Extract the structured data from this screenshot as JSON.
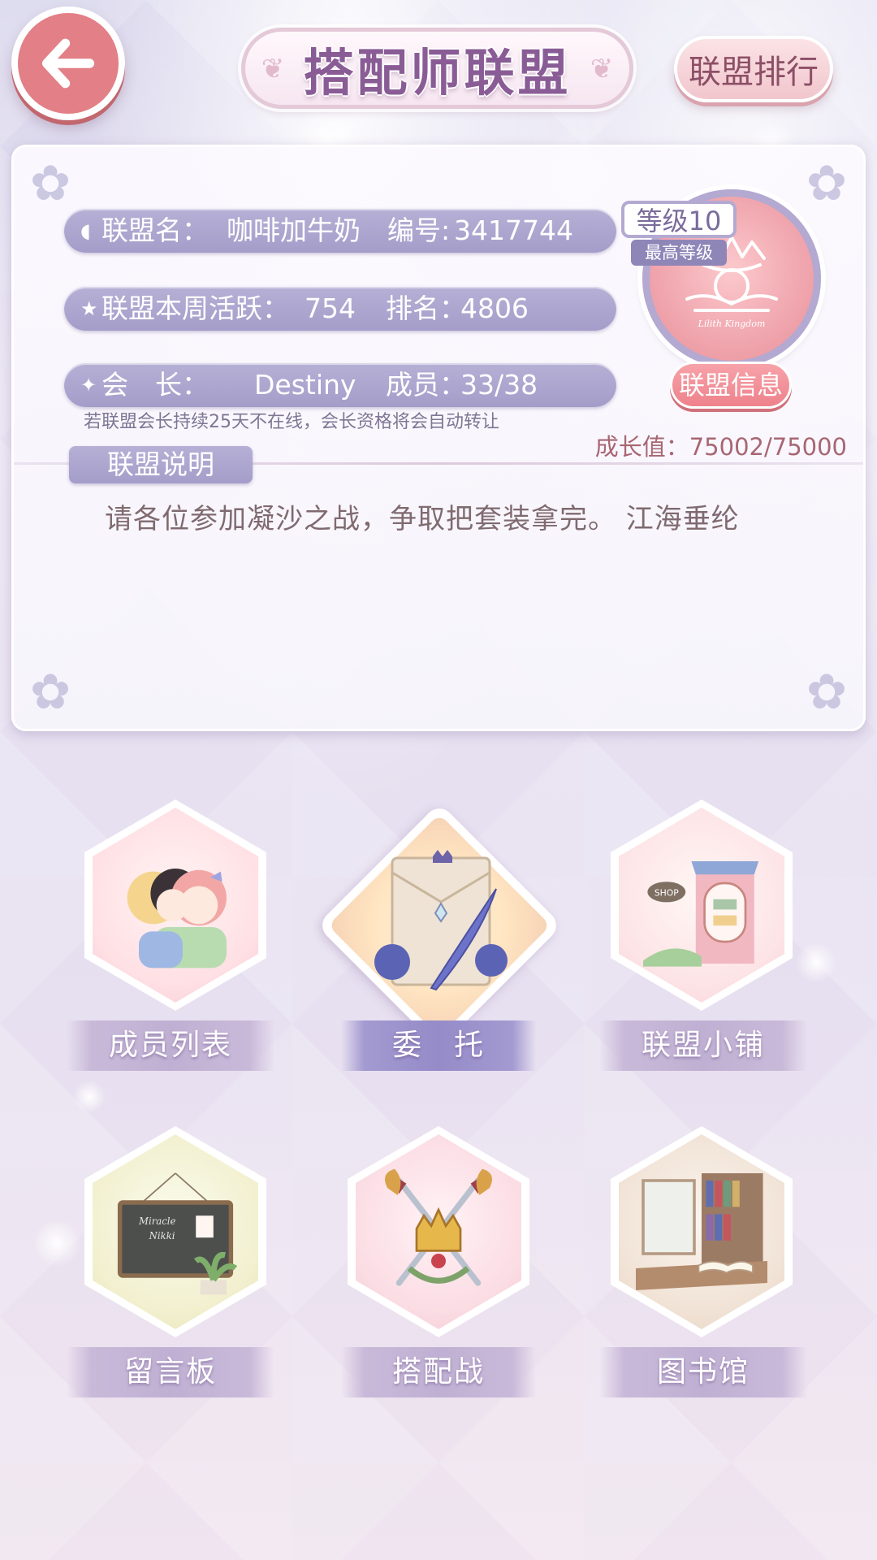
{
  "header": {
    "title": "搭配师联盟",
    "rank_button": "联盟排行"
  },
  "alliance": {
    "name_label": "联盟名：",
    "name": "咖啡加牛奶",
    "id_label": "编号:",
    "id": "3417744",
    "weekly_activity_label": "联盟本周活跃：",
    "weekly_activity": "754",
    "rank_label": "排名：",
    "rank": "4806",
    "leader_label": "会　长：",
    "leader": "Destiny",
    "members_label": "成员：",
    "members": "33/38",
    "leader_notice": "若联盟会长持续25天不在线，会长资格将会自动转让",
    "level": "等级10",
    "level_sub": "最高等级",
    "info_button": "联盟信息",
    "growth_label": "成长值：",
    "growth": "75002/75000",
    "description_tab": "联盟说明",
    "description": "请各位参加凝沙之战，争取把套装拿完。 江海垂纶",
    "crest_text": "Lilith Kingdom"
  },
  "menu": [
    {
      "label": "成员列表",
      "icon": "members-icon"
    },
    {
      "label": "委　托",
      "icon": "commission-icon"
    },
    {
      "label": "联盟小铺",
      "icon": "shop-icon"
    },
    {
      "label": "留言板",
      "icon": "message-board-icon"
    },
    {
      "label": "搭配战",
      "icon": "battle-icon"
    },
    {
      "label": "图书馆",
      "icon": "library-icon"
    }
  ],
  "colors": {
    "accent": "#a49dc9",
    "back_button": "#e37f86",
    "title": "#8a5c96"
  }
}
